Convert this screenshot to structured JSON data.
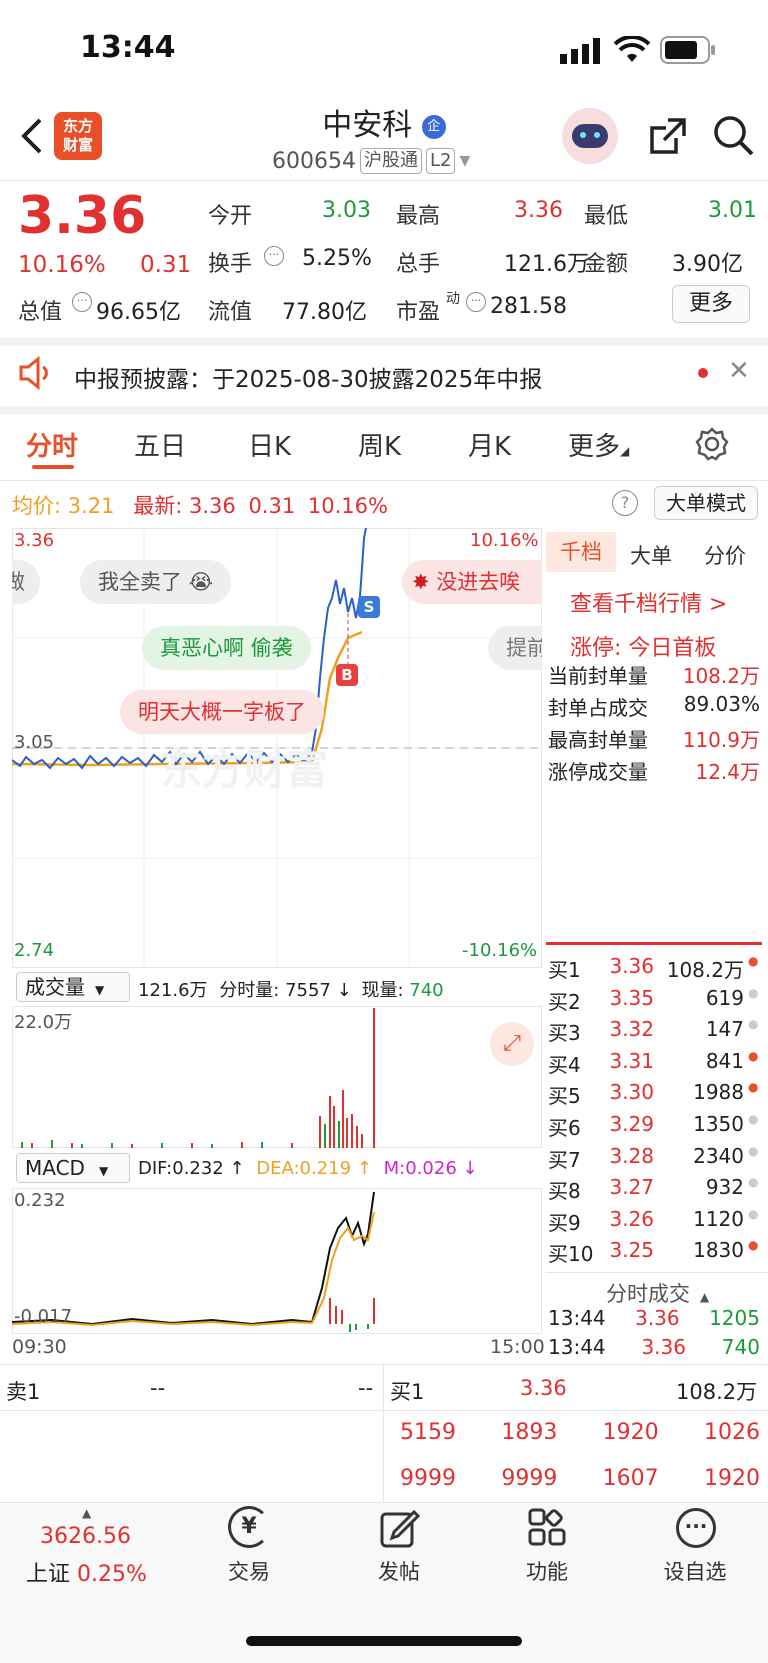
{
  "status": {
    "time": "13:44"
  },
  "header": {
    "logo_line1": "东方",
    "logo_line2": "财富",
    "name": "中安科",
    "name_badge": "企",
    "code": "600654",
    "tag1": "沪股通",
    "tag2": "L2"
  },
  "quote": {
    "price": "3.36",
    "pct": "10.16%",
    "change": "0.31",
    "open_label": "今开",
    "open": "3.03",
    "high_label": "最高",
    "high": "3.36",
    "low_label": "最低",
    "low": "3.01",
    "turnover_label": "换手",
    "turnover": "5.25%",
    "volume_label": "总手",
    "volume": "121.6万",
    "amount_label": "金额",
    "amount": "3.90亿",
    "mcap_label": "总值",
    "mcap": "96.65亿",
    "float_label": "流值",
    "float": "77.80亿",
    "pe_label": "市盈",
    "pe_sup": "动",
    "pe": "281.58",
    "more": "更多"
  },
  "notice": {
    "text": "中报预披露：于2025-08-30披露2025年中报"
  },
  "tabs": [
    "分时",
    "五日",
    "日K",
    "周K",
    "月K",
    "更多"
  ],
  "intraday": {
    "avg_label": "均价:",
    "avg": "3.21",
    "latest_label": "最新:",
    "latest": "3.36",
    "latest_chg": "0.31",
    "latest_pct": "10.16%",
    "mode_btn": "大单模式",
    "y_top": "3.36",
    "y_mid": "3.05",
    "y_bottom": "2.74",
    "pct_top": "10.16%",
    "pct_bottom": "-10.16%",
    "bubble1": "我全卖了",
    "bubble2": "没进去唉",
    "bubble3": "真恶心啊 偷袭",
    "bubble4": "提前",
    "bubble5": "明天大概一字板了",
    "bubble0": "做",
    "marker_s": "S",
    "marker_b": "B",
    "watermark": "东方财富"
  },
  "volume": {
    "label": "成交量",
    "total": "121.6万",
    "fen_label": "分时量:",
    "fen": "7557",
    "arrow": "↓",
    "now_label": "现量:",
    "now": "740",
    "ymax": "22.0万"
  },
  "macd": {
    "label": "MACD",
    "dif": "DIF:0.232 ↑",
    "dea": "DEA:0.219 ↑",
    "m": "M:0.026 ↓",
    "ytop": "0.232",
    "ybottom": "-0.017",
    "time_start": "09:30",
    "time_end": "15:00"
  },
  "panel": {
    "tabs": [
      "千档",
      "大单",
      "分价"
    ],
    "view_link": "查看千档行情 >",
    "limit_label": "涨停:",
    "limit_val": "今日首板",
    "rows": [
      {
        "label": "当前封单量",
        "value": "108.2万"
      },
      {
        "label": "封单占成交",
        "value": "89.03%"
      },
      {
        "label": "最高封单量",
        "value": "110.9万"
      },
      {
        "label": "涨停成交量",
        "value": "12.4万"
      }
    ],
    "book": [
      {
        "label": "买1",
        "price": "3.36",
        "vol": "108.2万"
      },
      {
        "label": "买2",
        "price": "3.35",
        "vol": "619"
      },
      {
        "label": "买3",
        "price": "3.32",
        "vol": "147"
      },
      {
        "label": "买4",
        "price": "3.31",
        "vol": "841"
      },
      {
        "label": "买5",
        "price": "3.30",
        "vol": "1988"
      },
      {
        "label": "买6",
        "price": "3.29",
        "vol": "1350"
      },
      {
        "label": "买7",
        "price": "3.28",
        "vol": "2340"
      },
      {
        "label": "买8",
        "price": "3.27",
        "vol": "932"
      },
      {
        "label": "买9",
        "price": "3.26",
        "vol": "1120"
      },
      {
        "label": "买10",
        "price": "3.25",
        "vol": "1830"
      }
    ],
    "ticks_title": "分时成交",
    "ticks": [
      {
        "time": "13:44",
        "price": "3.36",
        "vol": "1205"
      },
      {
        "time": "13:44",
        "price": "3.36",
        "vol": "740"
      }
    ]
  },
  "level2": {
    "sell_label": "卖1",
    "sell_price": "--",
    "sell_vol": "--",
    "buy_label": "买1",
    "buy_price": "3.36",
    "buy_vol": "108.2万",
    "row1": [
      "5159",
      "1893",
      "1920",
      "1026"
    ],
    "row2": [
      "9999",
      "9999",
      "1607",
      "1920"
    ]
  },
  "bottom": {
    "index_val": "3626.56",
    "index_name": "上证",
    "index_pct": "0.25%",
    "trade": "交易",
    "post": "发帖",
    "func": "功能",
    "watch": "设自选"
  }
}
